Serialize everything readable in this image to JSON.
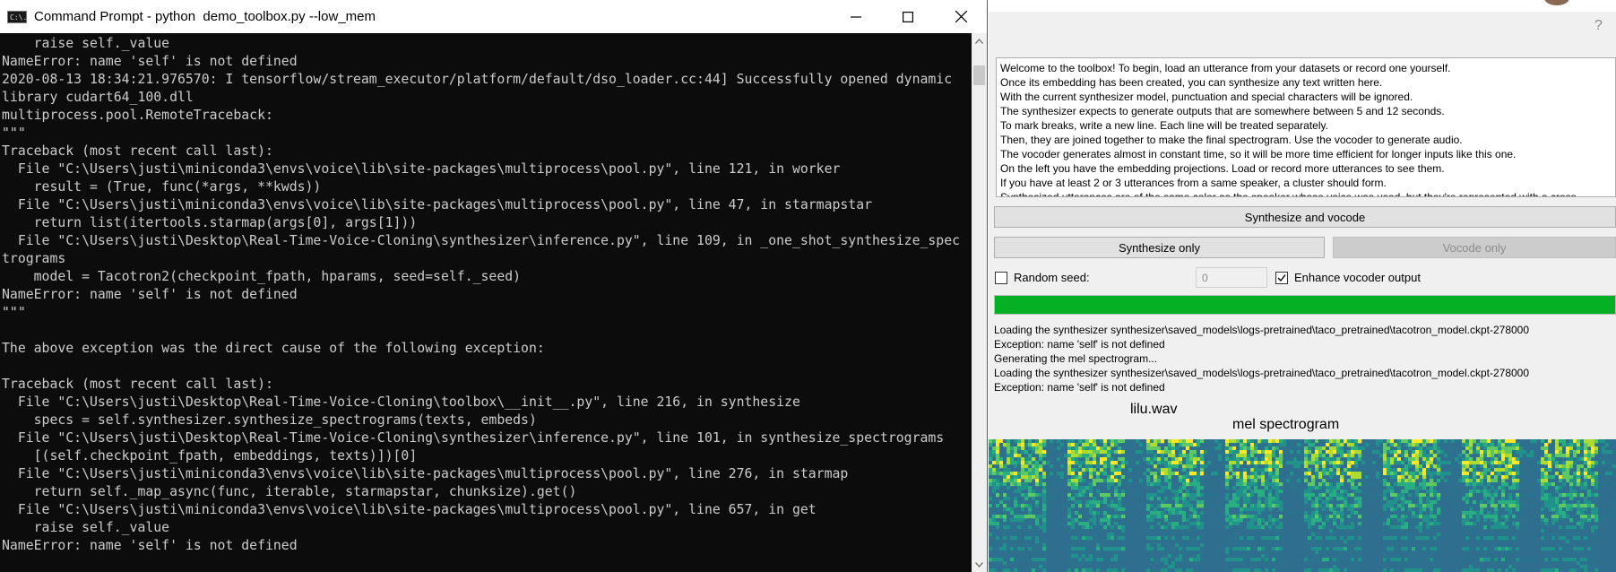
{
  "cmd": {
    "title": "Command Prompt - python  demo_toolbox.py --low_mem",
    "icon_text": "C:\\.",
    "output": "    raise self._value\nNameError: name 'self' is not defined\n2020-08-13 18:34:21.976570: I tensorflow/stream_executor/platform/default/dso_loader.cc:44] Successfully opened dynamic\nlibrary cudart64_100.dll\nmultiprocess.pool.RemoteTraceback:\n\"\"\"\nTraceback (most recent call last):\n  File \"C:\\Users\\justi\\miniconda3\\envs\\voice\\lib\\site-packages\\multiprocess\\pool.py\", line 121, in worker\n    result = (True, func(*args, **kwds))\n  File \"C:\\Users\\justi\\miniconda3\\envs\\voice\\lib\\site-packages\\multiprocess\\pool.py\", line 47, in starmapstar\n    return list(itertools.starmap(args[0], args[1]))\n  File \"C:\\Users\\justi\\Desktop\\Real-Time-Voice-Cloning\\synthesizer\\inference.py\", line 109, in _one_shot_synthesize_spec\ntrograms\n    model = Tacotron2(checkpoint_fpath, hparams, seed=self._seed)\nNameError: name 'self' is not defined\n\"\"\"\n\nThe above exception was the direct cause of the following exception:\n\nTraceback (most recent call last):\n  File \"C:\\Users\\justi\\Desktop\\Real-Time-Voice-Cloning\\toolbox\\__init__.py\", line 216, in synthesize\n    specs = self.synthesizer.synthesize_spectrograms(texts, embeds)\n  File \"C:\\Users\\justi\\Desktop\\Real-Time-Voice-Cloning\\synthesizer\\inference.py\", line 101, in synthesize_spectrograms\n    [(self.checkpoint_fpath, embeddings, texts)])[0]\n  File \"C:\\Users\\justi\\miniconda3\\envs\\voice\\lib\\site-packages\\multiprocess\\pool.py\", line 276, in starmap\n    return self._map_async(func, iterable, starmapstar, chunksize).get()\n  File \"C:\\Users\\justi\\miniconda3\\envs\\voice\\lib\\site-packages\\multiprocess\\pool.py\", line 657, in get\n    raise self._value\nNameError: name 'self' is not defined",
    "icons": {
      "minimize": "minimize-icon",
      "maximize": "maximize-icon",
      "close": "close-icon"
    }
  },
  "toolbox": {
    "help": "?",
    "instructions": [
      "Welcome to the toolbox! To begin, load an utterance from your datasets or record one yourself.",
      "Once its embedding has been created, you can synthesize any text written here.",
      "With the current synthesizer model, punctuation and special characters will be ignored.",
      "The synthesizer expects to generate outputs that are somewhere between 5 and 12 seconds.",
      "To mark breaks, write a new line. Each line will be treated separately.",
      "Then, they are joined together to make the final spectrogram. Use the vocoder to generate audio.",
      "The vocoder generates almost in constant time, so it will be more time efficient for longer inputs like this one.",
      "On the left you have the embedding projections. Load or record more utterances to see them.",
      "If you have at least 2 or 3 utterances from a same speaker, a cluster should form.",
      "Synthesized utterances are of the same color as the speaker whose voice was used, but they're represented with a cross."
    ],
    "synthesize_vocode_label": "Synthesize and vocode",
    "synthesize_only_label": "Synthesize only",
    "vocode_only_label": "Vocode only",
    "random_seed_label": "Random seed:",
    "random_seed_checked": false,
    "seed_value": "0",
    "enhance_label": "Enhance vocoder output",
    "enhance_checked": true,
    "progress": 1.0,
    "progress_color": "#06b025",
    "log": [
      "Loading the synthesizer synthesizer\\saved_models\\logs-pretrained\\taco_pretrained\\tacotron_model.ckpt-278000",
      "Exception: name 'self' is not defined",
      "Generating the mel spectrogram...",
      "Loading the synthesizer synthesizer\\saved_models\\logs-pretrained\\taco_pretrained\\tacotron_model.ckpt-278000",
      "Exception: name 'self' is not defined"
    ],
    "wav_title": "lilu.wav",
    "mel_title": "mel spectrogram"
  }
}
